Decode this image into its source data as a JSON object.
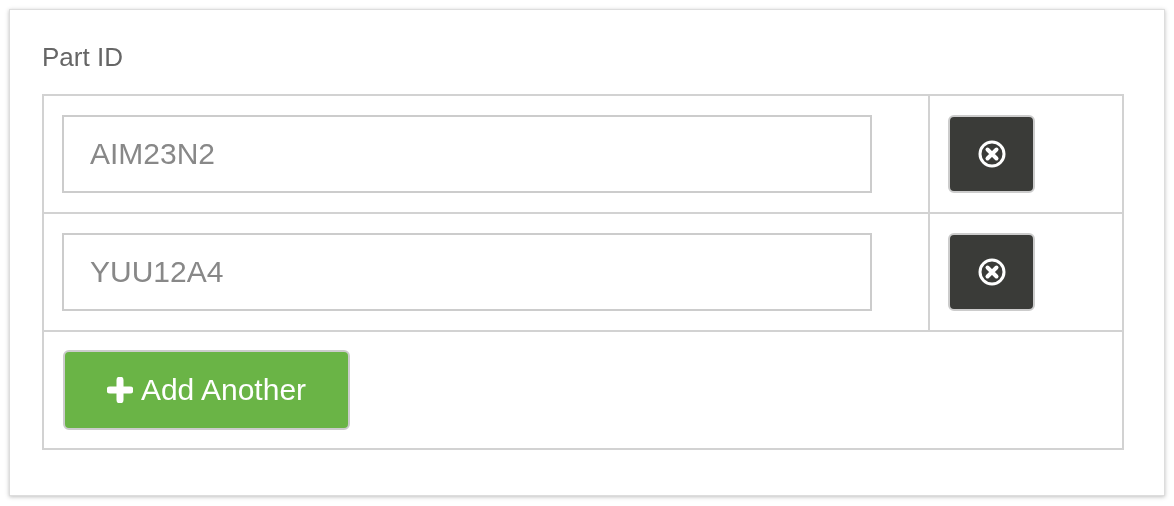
{
  "field": {
    "label": "Part ID"
  },
  "rows": [
    {
      "value": "AIM23N2"
    },
    {
      "value": "YUU12A4"
    }
  ],
  "add_button": {
    "label": "Add Another"
  }
}
